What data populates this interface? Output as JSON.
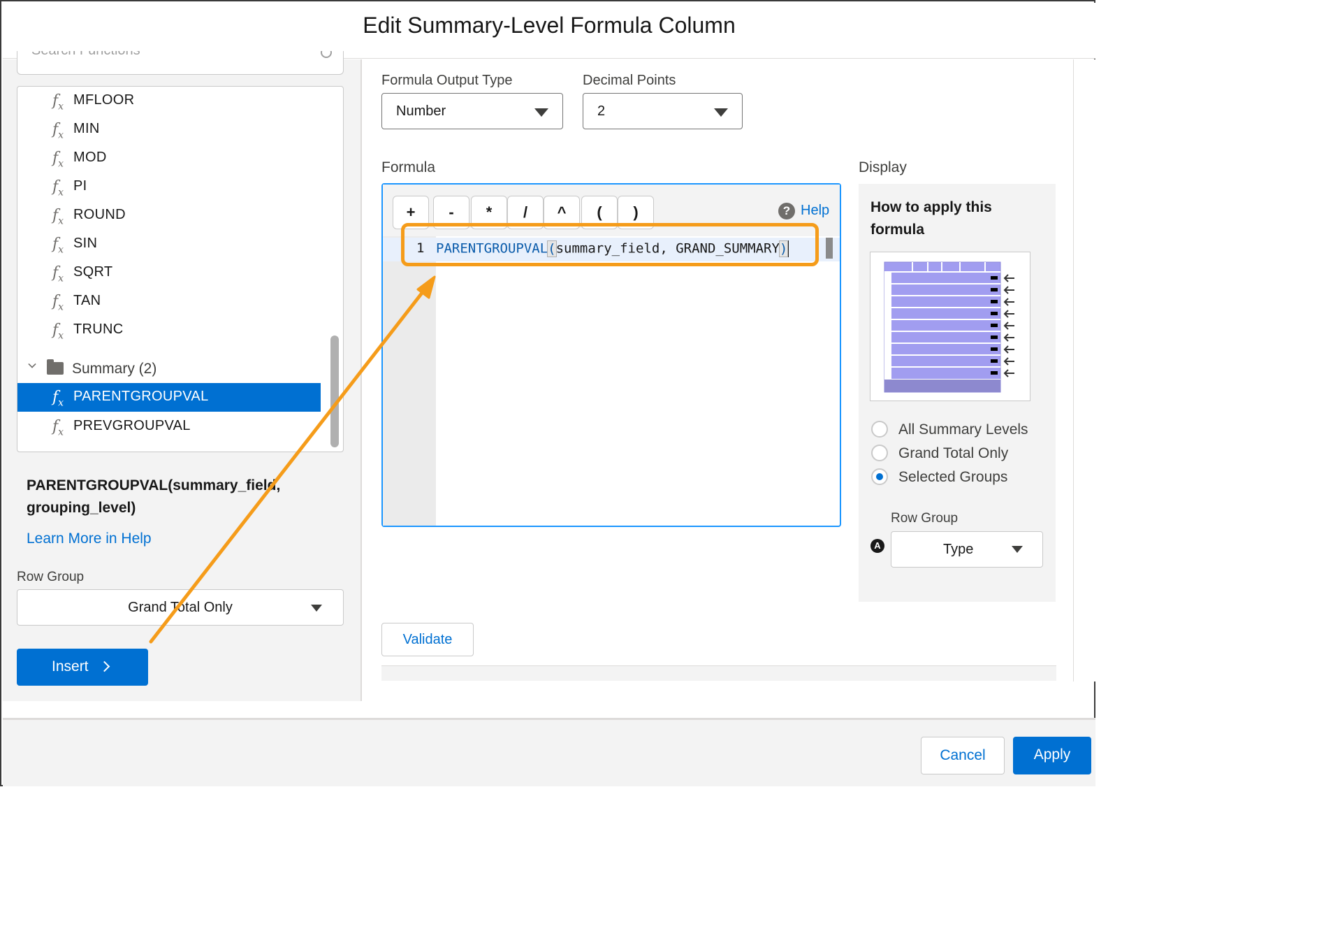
{
  "dialog": {
    "title": "Edit Summary-Level Formula Column"
  },
  "sidebar": {
    "search_placeholder": "Search Functions",
    "functions": [
      {
        "label": "MFLOOR"
      },
      {
        "label": "MIN"
      },
      {
        "label": "MOD"
      },
      {
        "label": "PI"
      },
      {
        "label": "ROUND"
      },
      {
        "label": "SIN"
      },
      {
        "label": "SQRT"
      },
      {
        "label": "TAN"
      },
      {
        "label": "TRUNC"
      }
    ],
    "summary_folder": "Summary (2)",
    "summary_functions": [
      {
        "label": "PARENTGROUPVAL",
        "selected": true
      },
      {
        "label": "PREVGROUPVAL",
        "selected": false
      }
    ],
    "fx_symbol": "f",
    "fx_sub": "x",
    "signature": "PARENTGROUPVAL(summary_field, grouping_level)",
    "learn_more": "Learn More in Help",
    "row_group_label": "Row Group",
    "row_group_value": "Grand Total Only",
    "insert_label": "Insert"
  },
  "output": {
    "type_label": "Formula Output Type",
    "type_value": "Number",
    "decimal_label": "Decimal Points",
    "decimal_value": "2"
  },
  "formula": {
    "label": "Formula",
    "operators": [
      "+",
      "-",
      "*",
      "/",
      "^",
      "(",
      ")"
    ],
    "help_label": "Help",
    "line_number": "1",
    "code_fn": "PARENTGROUPVAL",
    "code_open": "(",
    "code_args": "summary_field, GRAND_SUMMARY",
    "code_close": ")",
    "validate_label": "Validate"
  },
  "display": {
    "label": "Display",
    "heading": "How to apply this formula",
    "options": [
      {
        "label": "All Summary Levels",
        "checked": false
      },
      {
        "label": "Grand Total Only",
        "checked": false
      },
      {
        "label": "Selected Groups",
        "checked": true
      }
    ],
    "row_group_label": "Row Group",
    "row_group_value": "Type",
    "badge": "A"
  },
  "footer": {
    "cancel_label": "Cancel",
    "apply_label": "Apply"
  },
  "colors": {
    "brand": "#0070d2",
    "highlight": "#f59c1a",
    "illustration": "#a19df0"
  }
}
